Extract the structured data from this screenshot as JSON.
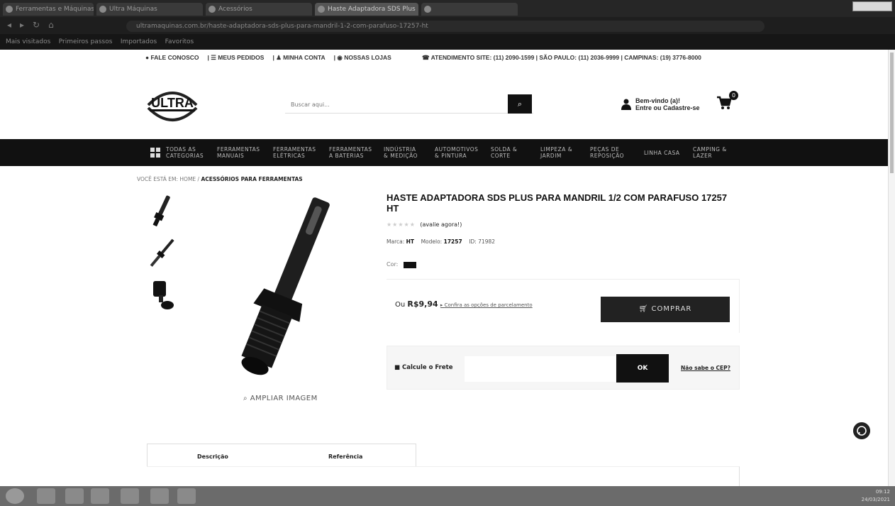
{
  "browser": {
    "tabs": [
      "Ferramentas e Máquinas",
      "Ultra Máquinas",
      "Acessórios",
      "Haste Adaptadora SDS Plus",
      ""
    ],
    "address": "ultramaquinas.com.br/haste-adaptadora-sds-plus-para-mandril-1-2-com-parafuso-17257-ht",
    "bookmarks": [
      "Mais visitados",
      "Primeiros passos",
      "Importados",
      "Favoritos"
    ]
  },
  "topbar": {
    "contact": "FALE CONOSCO",
    "orders": "MEUS PEDIDOS",
    "account": "MINHA CONTA",
    "stores": "NOSSAS LOJAS",
    "support": "ATENDIMENTO SITE: (11) 2090-1599  |  SÃO PAULO: (11) 2036-9999  |  CAMPINAS: (19) 3776-8000"
  },
  "header": {
    "logo_text": "ULTRA",
    "search_placeholder": "Buscar aqui...",
    "welcome": "Bem-vindo (a)!",
    "login": "Entre ou Cadastre-se",
    "cart_count": "0"
  },
  "categories": [
    {
      "l1": "TODAS AS",
      "l2": "CATEGORIAS"
    },
    {
      "l1": "FERRAMENTAS",
      "l2": "MANUAIS"
    },
    {
      "l1": "FERRAMENTAS",
      "l2": "ELÉTRICAS"
    },
    {
      "l1": "FERRAMENTAS",
      "l2": "A BATERIAS"
    },
    {
      "l1": "INDÚSTRIA",
      "l2": "& MEDIÇÃO"
    },
    {
      "l1": "AUTOMOTIVOS",
      "l2": "& PINTURA"
    },
    {
      "l1": "SOLDA &",
      "l2": "CORTE"
    },
    {
      "l1": "LIMPEZA &",
      "l2": "JARDIM"
    },
    {
      "l1": "PEÇAS DE",
      "l2": "REPOSIÇÃO"
    },
    {
      "l1": "LINHA CASA",
      "l2": ""
    },
    {
      "l1": "CAMPING &",
      "l2": "LAZER"
    }
  ],
  "breadcrumb": {
    "prefix": "VOCÊ ESTÁ EM: HOME  /",
    "current": "ACESSÓRIOS PARA FERRAMENTAS"
  },
  "product": {
    "title": "HASTE ADAPTADORA SDS PLUS PARA MANDRIL 1/2 COM PARAFUSO 17257 HT",
    "stars": "★★★★★",
    "rate_cta": "(avalie agora!)",
    "brand_label": "Marca:",
    "brand": "HT",
    "model_label": "Modelo:",
    "model": "17257",
    "id": "ID: 71982",
    "color_label": "Cor:",
    "color": "#111111",
    "price_prefix": "Ou",
    "price": "R$9,94",
    "installments": "Confira as opções de parcelamento",
    "buy": "COMPRAR",
    "zoom": "AMPLIAR IMAGEM"
  },
  "freight": {
    "label": "Calcule o Frete",
    "ok": "OK",
    "cep_help": "Não sabe o CEP?"
  },
  "tabs": {
    "description": "Descrição",
    "reference": "Referência"
  },
  "taskbar": {
    "time": "09:12",
    "date": "24/03/2021"
  }
}
